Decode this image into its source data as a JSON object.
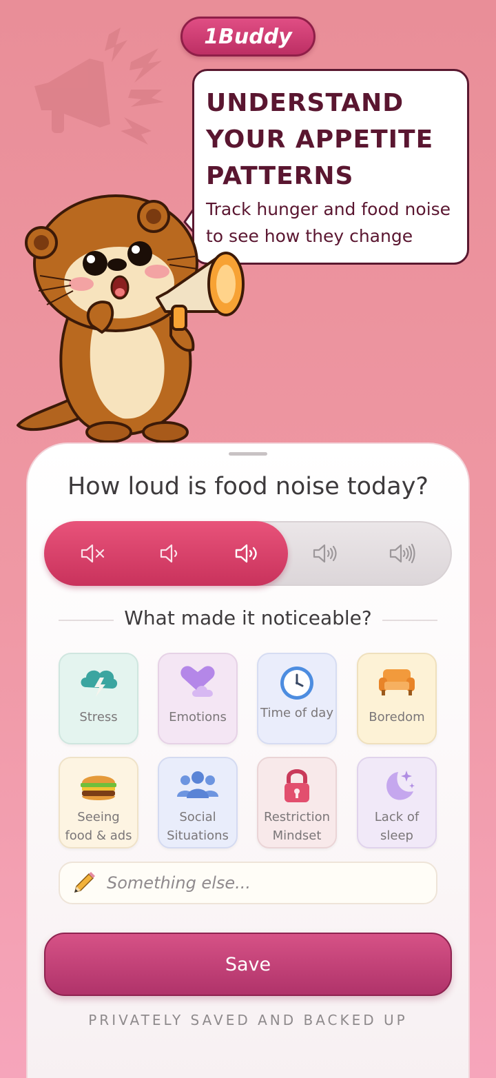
{
  "brand": {
    "name": "1Buddy"
  },
  "bubble": {
    "title_lines": [
      "UNDERSTAND",
      "YOUR APPETITE",
      "PATTERNS"
    ],
    "subtitle_lines": [
      "Track hunger and food noise",
      "to see how they change"
    ]
  },
  "sheet": {
    "question": "How loud is food noise today?",
    "volume": {
      "levels": [
        "muted",
        "quiet",
        "medium",
        "loud",
        "very-loud"
      ],
      "selected_level": 3,
      "total_levels": 5
    },
    "section_title": "What made it noticeable?",
    "triggers": [
      {
        "label": "Stress",
        "icon": "storm-cloud-icon"
      },
      {
        "label": "Emotions",
        "icon": "heart-cloud-icon"
      },
      {
        "label": "Time of day",
        "icon": "clock-icon"
      },
      {
        "label": "Boredom",
        "icon": "couch-icon"
      },
      {
        "label": "Seeing food & ads",
        "icon": "burger-icon"
      },
      {
        "label": "Social Situations",
        "icon": "people-icon"
      },
      {
        "label": "Restriction Mindset",
        "icon": "lock-icon"
      },
      {
        "label": "Lack of sleep",
        "icon": "moon-stars-icon"
      }
    ],
    "other_placeholder": "Something else...",
    "save_label": "Save",
    "footer_note": "PRIVATELY SAVED AND BACKED UP"
  },
  "colors": {
    "accent": "#d04a7c",
    "background": "#ee96a2",
    "text_dark": "#5a1630"
  }
}
